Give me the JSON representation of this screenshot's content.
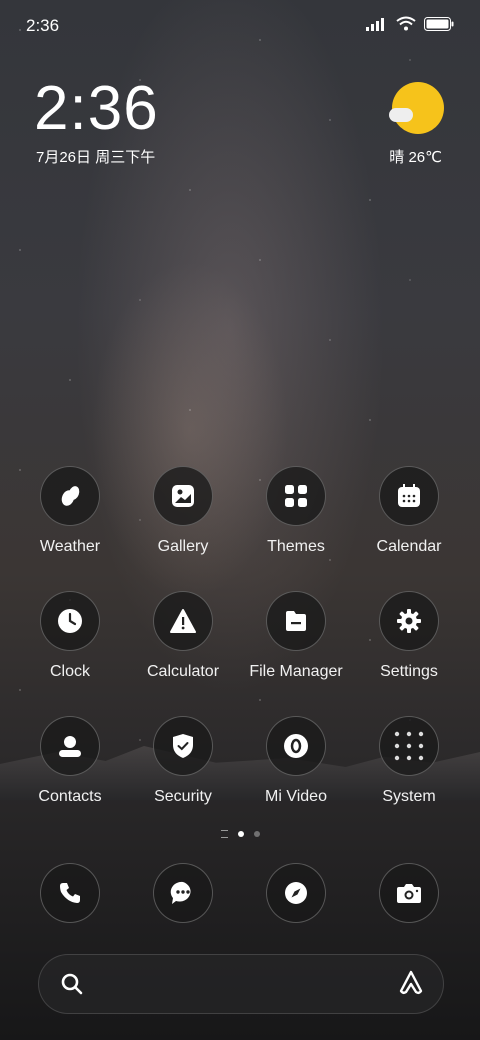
{
  "status_bar": {
    "time": "2:36",
    "icons": [
      "signal-icon",
      "wifi-icon",
      "battery-icon"
    ]
  },
  "clock_widget": {
    "time": "2:36",
    "date": "7月26日 周三下午"
  },
  "weather_widget": {
    "text": "晴 26℃",
    "icon": "sunny-cloud-icon",
    "color": "#f6c31b"
  },
  "apps": [
    {
      "label": "Weather",
      "icon": "weather-drops-icon"
    },
    {
      "label": "Gallery",
      "icon": "gallery-icon"
    },
    {
      "label": "Themes",
      "icon": "themes-grid-icon"
    },
    {
      "label": "Calendar",
      "icon": "calendar-icon"
    },
    {
      "label": "Clock",
      "icon": "clock-icon"
    },
    {
      "label": "Calculator",
      "icon": "calculator-warning-icon"
    },
    {
      "label": "File Manager",
      "icon": "folder-icon"
    },
    {
      "label": "Settings",
      "icon": "gear-icon"
    },
    {
      "label": "Contacts",
      "icon": "contacts-icon"
    },
    {
      "label": "Security",
      "icon": "shield-check-icon"
    },
    {
      "label": "Mi Video",
      "icon": "video-icon"
    },
    {
      "label": "System",
      "icon": "folder-grid-icon"
    }
  ],
  "page_indicator": {
    "pages": 2,
    "active": 1
  },
  "dock": [
    {
      "icon": "phone-icon"
    },
    {
      "icon": "messages-icon"
    },
    {
      "icon": "browser-compass-icon"
    },
    {
      "icon": "camera-icon"
    }
  ],
  "search_bar": {
    "left_icon": "search-icon",
    "right_icon": "assistant-icon"
  }
}
